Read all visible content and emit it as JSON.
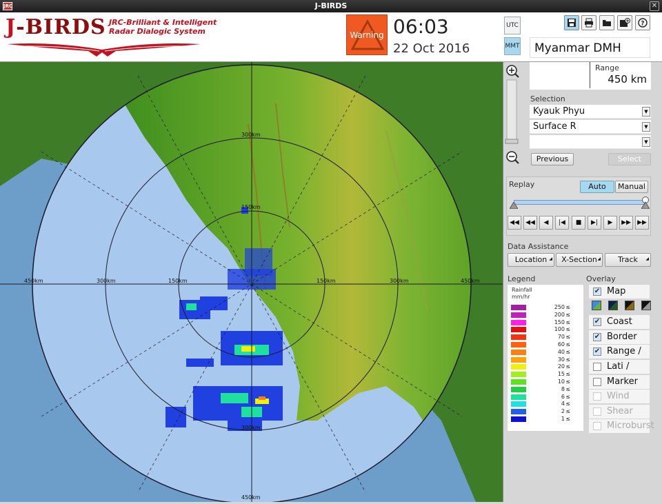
{
  "window": {
    "title": "J-BIRDS",
    "app_icon": "JRC"
  },
  "logo": {
    "brand_j": "J",
    "brand_rest": "-BIRDS",
    "tagline_1": "JRC-Brilliant & Intelligent",
    "tagline_2": "Radar Dialogic System"
  },
  "header": {
    "warning_label": "Warning",
    "time": "06:03",
    "date": "22 Oct 2016",
    "utc_label": "UTC",
    "mmt_label": "MMT",
    "radar_name": "Myanmar DMH"
  },
  "map": {
    "ring_labels": [
      "150km",
      "300km",
      "450km"
    ],
    "colors": {
      "sea": "#a9c8ee",
      "land_low": "#5aa02a",
      "land_high": "#c8c03a",
      "outside": "#6d9ec9"
    }
  },
  "panel": {
    "range_label": "Range",
    "range_value": "450 km",
    "selection_label": "Selection",
    "selection_values": [
      "Kyauk Phyu",
      "Surface R",
      ""
    ],
    "previous_label": "Previous",
    "select_label": "Select",
    "replay_label": "Replay",
    "auto_label": "Auto",
    "manual_label": "Manual",
    "data_assistance_label": "Data Assistance",
    "location_label": "Location",
    "xsection_label": "X-Section",
    "track_label": "Track",
    "legend_label": "Legend",
    "legend_unit_1": "Rainfall",
    "legend_unit_2": "mm/hr",
    "legend_items": [
      {
        "value": "250",
        "color": "#a020a0"
      },
      {
        "value": "200",
        "color": "#c020c0"
      },
      {
        "value": "150",
        "color": "#ff20e0"
      },
      {
        "value": "100",
        "color": "#e01010"
      },
      {
        "value": "70",
        "color": "#ff3010"
      },
      {
        "value": "60",
        "color": "#ff6010"
      },
      {
        "value": "40",
        "color": "#ff8010"
      },
      {
        "value": "30",
        "color": "#ffa010"
      },
      {
        "value": "20",
        "color": "#f0f010"
      },
      {
        "value": "15",
        "color": "#a0f020"
      },
      {
        "value": "10",
        "color": "#60e020"
      },
      {
        "value": "8",
        "color": "#20d040"
      },
      {
        "value": "6",
        "color": "#20e0a0"
      },
      {
        "value": "4",
        "color": "#20e0e0"
      },
      {
        "value": "2",
        "color": "#2060f0"
      },
      {
        "value": "1",
        "color": "#1010d0"
      }
    ],
    "legend_le": "≤",
    "overlay_label": "Overlay",
    "overlays": [
      {
        "label": "Map",
        "checked": "✔"
      },
      {
        "label": "Coast",
        "checked": "✔"
      },
      {
        "label": "Border",
        "checked": "✔"
      },
      {
        "label": "Range / AZ",
        "checked": "✔"
      },
      {
        "label": "Lati / Long",
        "checked": ""
      },
      {
        "label": "Marker",
        "checked": ""
      },
      {
        "label": "Wind",
        "checked": ""
      },
      {
        "label": "Shear Line",
        "checked": ""
      },
      {
        "label": "Microburst",
        "checked": ""
      }
    ]
  }
}
